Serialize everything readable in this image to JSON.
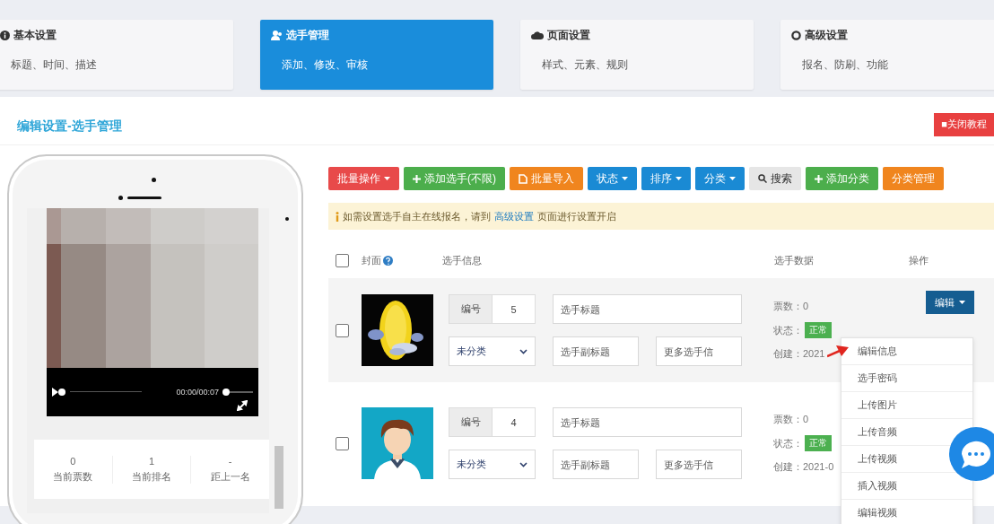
{
  "nav_cards": [
    {
      "title": "基本设置",
      "subtitle": "标题、时间、描述",
      "selected": false
    },
    {
      "title": "选手管理",
      "subtitle": "添加、修改、审核",
      "selected": true
    },
    {
      "title": "页面设置",
      "subtitle": "样式、元素、规则",
      "selected": false
    },
    {
      "title": "高级设置",
      "subtitle": "报名、防刷、功能",
      "selected": false
    }
  ],
  "page_title": "编辑设置-选手管理",
  "close_button": "■关闭教程",
  "toolbar": [
    {
      "label": "批量操作",
      "dropdown": true,
      "color": "#e84a4a"
    },
    {
      "label": "添加选手(不限)",
      "dropdown": false,
      "color": "#4cae4c"
    },
    {
      "label": "批量导入",
      "dropdown": false,
      "color": "#f0851e"
    },
    {
      "label": "状态",
      "dropdown": true,
      "color": "#1a8ad4"
    },
    {
      "label": "排序",
      "dropdown": true,
      "color": "#1a8ad4"
    },
    {
      "label": "分类",
      "dropdown": true,
      "color": "#1a8ad4"
    },
    {
      "label": "搜索",
      "dropdown": false,
      "color": "#e6e6e6"
    },
    {
      "label": "添加分类",
      "dropdown": false,
      "color": "#4cae4c"
    },
    {
      "label": "分类管理",
      "dropdown": false,
      "color": "#f0851e"
    }
  ],
  "notice": {
    "text": "如需设置选手自主在线报名，请到",
    "link": "高级设置",
    "after": "页面进行设置开启"
  },
  "table": {
    "header_checkbox": {
      "checked": false
    },
    "columns": [
      "封面",
      "选手信息",
      "选手数据",
      "操作"
    ],
    "rows": [
      {
        "checked": false,
        "number_label": "编号",
        "number": "5",
        "title_placeholder": "选手标题",
        "category": "未分类",
        "subtitle_placeholder": "选手副标题",
        "info_placeholder": "更多选手信",
        "votes": "票数：0",
        "status_label": "状态：",
        "status": "正常",
        "created": "创建：2021",
        "action": "编辑"
      },
      {
        "checked": false,
        "number_label": "编号",
        "number": "4",
        "title_placeholder": "选手标题",
        "category": "未分类",
        "subtitle_placeholder": "选手副标题",
        "info_placeholder": "更多选手信",
        "votes": "票数：0",
        "status_label": "状态：",
        "status": "正常",
        "created": "创建：2021-0"
      }
    ]
  },
  "action_menu": [
    "编辑信息",
    "选手密码",
    "上传图片",
    "上传音频",
    "上传视频",
    "插入视频",
    "编辑视频"
  ],
  "preview": {
    "time": "00:00/00:07",
    "volume": {
      "level": 0
    },
    "stats": [
      {
        "value": "0",
        "label": "当前票数"
      },
      {
        "value": "1",
        "label": "当前排名"
      },
      {
        "value": "-",
        "label": "距上一名"
      }
    ]
  }
}
